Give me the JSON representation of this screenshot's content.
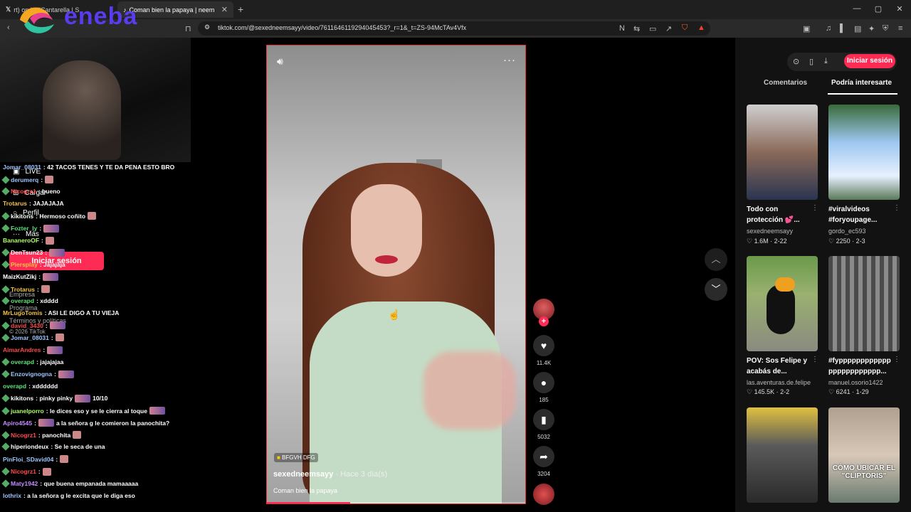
{
  "browser": {
    "tabs": [
      {
        "label": "rt) on X: \"Cantarella | S"
      },
      {
        "label": "Coman bien la papaya | neem"
      }
    ],
    "new_tab": "+",
    "url": "tiktok.com/@sexedneemsayy/video/7611646119294045453?_r=1&_t=ZS-94McTAv4Vfx",
    "window_controls": [
      "—",
      "▢",
      "✕"
    ]
  },
  "overlay": {
    "logo_text": "eneba"
  },
  "sidebar": {
    "items": [
      {
        "icon": "live-icon",
        "label": "LIVE"
      },
      {
        "icon": "upload-icon",
        "label": "Cargar"
      },
      {
        "icon": "profile-icon",
        "label": "Perfil"
      },
      {
        "icon": "more-icon",
        "label": "Más"
      }
    ],
    "login_label": "Iniciar sesión",
    "footer": [
      "Empresa",
      "Programa",
      "Términos y políticas",
      "© 2026 TikTok"
    ]
  },
  "chat": [
    {
      "user": "Jomar_08031",
      "color": "#9ec5ff",
      "text": ": 42 TACOS TENES Y TE DA PENA ESTO BRO",
      "emote": ""
    },
    {
      "user": "derumerq",
      "color": "#9ec5ff",
      "text": ":",
      "emote": "small"
    },
    {
      "user": "Nicogrz1",
      "color": "#ff4a4a",
      "text": ": bueno",
      "emote": ""
    },
    {
      "user": "Trotarus",
      "color": "#f5c542",
      "text": ": JAJAJAJA",
      "emote": ""
    },
    {
      "user": "kikitons",
      "color": "#ffffff",
      "text": ": Hermoso coñito",
      "emote": "small"
    },
    {
      "user": "Fozter_ly",
      "color": "#5ee07a",
      "text": ":",
      "emote": "wide"
    },
    {
      "user": "BananeroOF",
      "color": "#b0ff60",
      "text": ":",
      "emote": "small"
    },
    {
      "user": "DenTsun23",
      "color": "#ffffff",
      "text": ":",
      "emote": "wide"
    },
    {
      "user": "Piersplay",
      "color": "#f5c542",
      "text": ": Jajajaja",
      "emote": ""
    },
    {
      "user": "MaizKutZikj",
      "color": "#ffffff",
      "text": ":",
      "emote": "wide"
    },
    {
      "user": "Trotarus",
      "color": "#f5c542",
      "text": ":",
      "emote": "small"
    },
    {
      "user": "overapd",
      "color": "#5ee07a",
      "text": ": xdddd",
      "emote": ""
    },
    {
      "user": "MrLugoTomis",
      "color": "#f5c542",
      "text": ": ASI LE DIGO A TU VIEJA",
      "emote": ""
    },
    {
      "user": "david_3430",
      "color": "#ff4a4a",
      "text": ":",
      "emote": "wide"
    },
    {
      "user": "Jomar_08031",
      "color": "#9ec5ff",
      "text": ":",
      "emote": "small"
    },
    {
      "user": "AimarAndres",
      "color": "#ff4a4a",
      "text": ":",
      "emote": "wide"
    },
    {
      "user": "overapd",
      "color": "#5ee07a",
      "text": ": jajajajaa",
      "emote": ""
    },
    {
      "user": "Enzovignogna",
      "color": "#9ec5ff",
      "text": ":",
      "emote": "wide"
    },
    {
      "user": "overapd",
      "color": "#5ee07a",
      "text": ": xdddddd",
      "emote": ""
    },
    {
      "user": "kikitons",
      "color": "#ffffff",
      "text": ": pinky pinky",
      "emote": "wide",
      "after": "10/10"
    },
    {
      "user": "juanelporro",
      "color": "#b0ff60",
      "text": ": le dices eso y se le cierra al toque",
      "emote": "wide"
    },
    {
      "user": "Apiro4545",
      "color": "#c58cff",
      "text": ":",
      "emote": "wide",
      "after": "a la señora g le comieron la panochita?"
    },
    {
      "user": "Nicogrz1",
      "color": "#ff4a4a",
      "text": ": panochita",
      "emote": "small"
    },
    {
      "user": "hiperiondeux",
      "color": "#ffffff",
      "text": ": Se le seca de una",
      "emote": ""
    },
    {
      "user": "PinFloi_SDavid04",
      "color": "#9ec5ff",
      "text": ":",
      "emote": "small"
    },
    {
      "user": "Nicogrz1",
      "color": "#ff4a4a",
      "text": ":",
      "emote": "small"
    },
    {
      "user": "Maty1942",
      "color": "#c58cff",
      "text": ": que buena empanada mamaaaaa",
      "emote": ""
    },
    {
      "user": "lothrix",
      "color": "#9ec5ff",
      "text": ": a la señora g le excita que le diga eso",
      "emote": ""
    }
  ],
  "video": {
    "sticker": "BFGVH DFG",
    "author": "sexedneemsayy",
    "time": "· Hace 3 día(s)",
    "caption": "Coman bien la papaya",
    "progress": 0.32,
    "likes": "11.4K",
    "comments": "185",
    "saves": "5032",
    "shares": "3204"
  },
  "rightpanel": {
    "login_label": "Iniciar sesión",
    "tabs": [
      "Comentarios",
      "Podría interesarte"
    ],
    "cards": [
      {
        "title": "Todo con protección 💕...",
        "author": "sexedneemsayy",
        "stats": "♡ 1.6M · 2-22",
        "overlay": ""
      },
      {
        "title": "#viralvideos #foryoupage...",
        "author": "gordo_ec593",
        "stats": "♡ 2250 · 2-3",
        "overlay": ""
      },
      {
        "title": "POV: Sos Felipe y acabás de...",
        "author": "las.aventuras.de.felipe",
        "stats": "♡ 145.5K · 2-2",
        "overlay": ""
      },
      {
        "title": "#fypppppppppppp pppppppppppp...",
        "author": "manuel.osorio1422",
        "stats": "♡ 6241 · 1-29",
        "overlay": ""
      },
      {
        "title": "",
        "author": "",
        "stats": "",
        "overlay": ""
      },
      {
        "title": "",
        "author": "",
        "stats": "",
        "overlay": "CÓMO UBICAR EL \"CLIPTORIS\""
      }
    ]
  },
  "colors": {
    "accent": "#fe2c55",
    "video_border": "#e8303a"
  }
}
